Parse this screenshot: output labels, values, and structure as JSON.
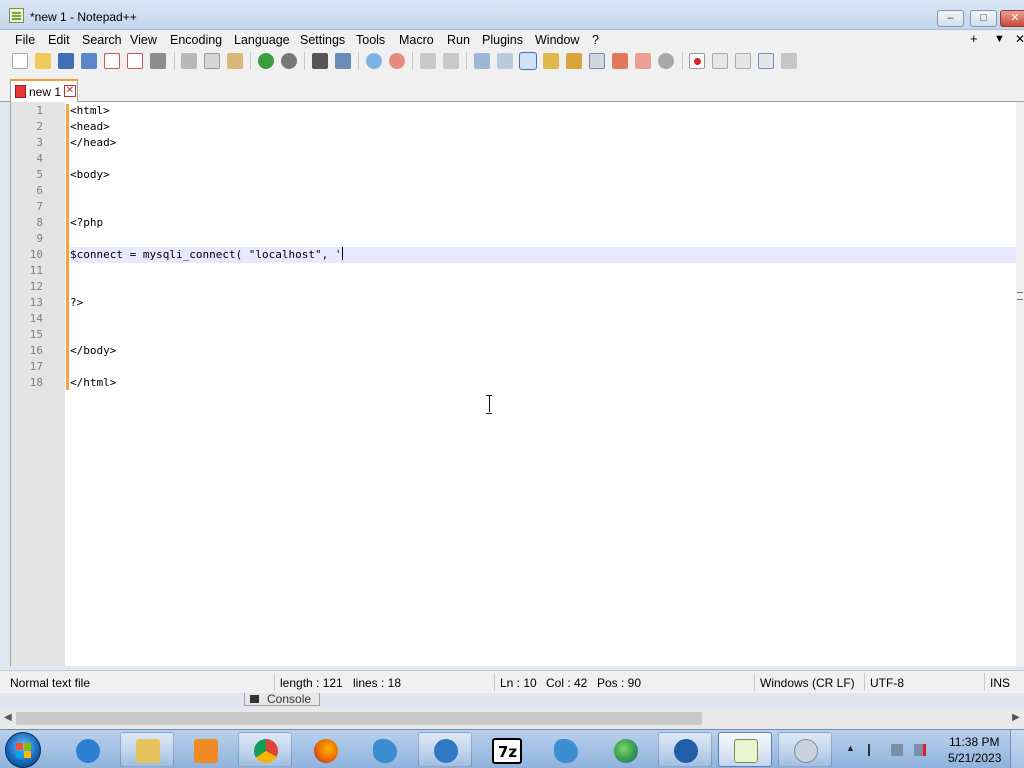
{
  "window": {
    "title": "*new 1 - Notepad++",
    "min_label": "–",
    "max_label": "□",
    "close_label": "✕"
  },
  "menu": {
    "items": [
      "File",
      "Edit",
      "Search",
      "View",
      "Encoding",
      "Language",
      "Settings",
      "Tools",
      "Macro",
      "Run",
      "Plugins",
      "Window",
      "?"
    ],
    "right": {
      "plus": "+",
      "down": "▼",
      "close": "✕"
    }
  },
  "toolbar": {
    "icons": [
      "new-file-icon",
      "open-file-icon",
      "save-icon",
      "save-all-icon",
      "close-icon",
      "close-all-icon",
      "print-icon",
      "cut-icon",
      "copy-icon",
      "paste-icon",
      "undo-icon",
      "redo-icon",
      "find-icon",
      "replace-icon",
      "zoom-in-icon",
      "zoom-out-icon",
      "sync-vertical-icon",
      "sync-horizontal-icon",
      "word-wrap-icon",
      "show-all-chars-icon",
      "indent-guide-icon",
      "udl-icon",
      "doc-map-icon",
      "function-list-icon",
      "folder-workspace-icon",
      "doc-switcher-icon",
      "monitoring-icon",
      "record-macro-icon",
      "stop-macro-icon",
      "play-macro-icon",
      "run-macro-multiple-icon",
      "save-macro-icon"
    ]
  },
  "tabs": [
    {
      "label": "new 1",
      "close": "✕",
      "active": true
    }
  ],
  "editor": {
    "lines": [
      "<html>",
      "<head>",
      "</head>",
      "",
      "<body>",
      "",
      "",
      "<?php",
      "",
      "$connect = mysqli_connect( \"localhost\", '",
      "",
      "",
      "?>",
      "",
      "",
      "</body>",
      "",
      "</html>"
    ],
    "line_numbers": [
      "1",
      "2",
      "3",
      "4",
      "5",
      "6",
      "7",
      "8",
      "9",
      "10",
      "11",
      "12",
      "13",
      "14",
      "15",
      "16",
      "17",
      "18"
    ],
    "current_line": 10,
    "colors": {
      "gutter": "#e4e4e4",
      "change_bar": "#f7a23a",
      "current_line": "#e8e8ff"
    }
  },
  "status": {
    "file_type": "Normal text file",
    "length": "length : 121",
    "lines": "lines : 18",
    "ln": "Ln : 10",
    "col": "Col : 42",
    "pos": "Pos : 90",
    "eol": "Windows (CR LF)",
    "encoding": "UTF-8",
    "mode": "INS"
  },
  "console": {
    "label": "Console"
  },
  "taskbar": {
    "apps": [
      {
        "name": "internet-explorer",
        "icon": "ie-icon",
        "color": "#2d7fd3"
      },
      {
        "name": "file-explorer",
        "icon": "folder-icon",
        "color": "#e8c25a"
      },
      {
        "name": "media-player",
        "icon": "media-player-icon",
        "color": "#f08a24"
      },
      {
        "name": "chrome",
        "icon": "chrome-icon",
        "color": "#db4437"
      },
      {
        "name": "firefox",
        "icon": "firefox-icon",
        "color": "#e66000"
      },
      {
        "name": "mysql-workbench",
        "icon": "dolphin-icon",
        "color": "#3b8ed0"
      },
      {
        "name": "network-tool",
        "icon": "globe-shield-icon",
        "color": "#2f78c4"
      },
      {
        "name": "7zip",
        "icon": "7zip-icon",
        "text": "7z",
        "color": "#ffffff"
      },
      {
        "name": "mysql-tool",
        "icon": "dolphin-icon",
        "color": "#3b8ed0"
      },
      {
        "name": "globe-app",
        "icon": "globe-icon",
        "color": "#3aa14a"
      },
      {
        "name": "xampp-like",
        "icon": "server-icon",
        "color": "#1f5fa8"
      },
      {
        "name": "notepad-plus-plus",
        "icon": "notepad-icon",
        "color": "#9ccc65"
      },
      {
        "name": "other-app",
        "icon": "lambda-icon",
        "color": "#c9d3df"
      }
    ],
    "clock_time": "11:38 PM",
    "clock_date": "5/21/2023"
  }
}
